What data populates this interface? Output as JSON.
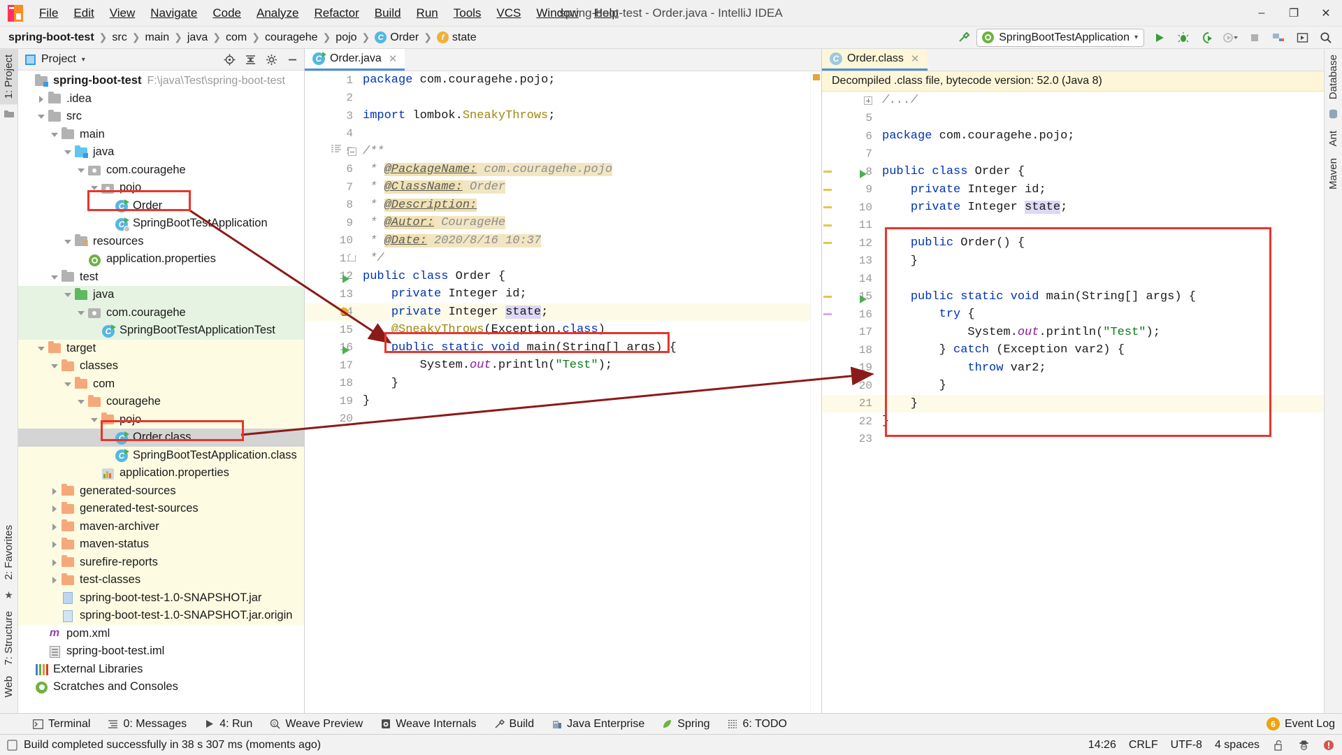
{
  "window": {
    "title": "spring-boot-test - Order.java - IntelliJ IDEA",
    "logo_letters": "IJ",
    "minimize": "–",
    "maximize": "❐",
    "close": "✕"
  },
  "menubar": [
    {
      "label": "File"
    },
    {
      "label": "Edit"
    },
    {
      "label": "View"
    },
    {
      "label": "Navigate"
    },
    {
      "label": "Code"
    },
    {
      "label": "Analyze"
    },
    {
      "label": "Refactor"
    },
    {
      "label": "Build"
    },
    {
      "label": "Run"
    },
    {
      "label": "Tools"
    },
    {
      "label": "VCS"
    },
    {
      "label": "Window"
    },
    {
      "label": "Help"
    }
  ],
  "breadcrumbs": [
    {
      "label": "spring-boot-test",
      "icon": "none",
      "bold": true
    },
    {
      "label": "src",
      "icon": "none",
      "bold": false
    },
    {
      "label": "main",
      "icon": "none",
      "bold": false
    },
    {
      "label": "java",
      "icon": "none",
      "bold": false
    },
    {
      "label": "com",
      "icon": "none",
      "bold": false
    },
    {
      "label": "couragehe",
      "icon": "none",
      "bold": false
    },
    {
      "label": "pojo",
      "icon": "none",
      "bold": false
    },
    {
      "label": "Order",
      "icon": "class-icon",
      "bold": false
    },
    {
      "label": "state",
      "icon": "field-icon",
      "bold": false
    }
  ],
  "toolbar": {
    "build_icon": "hammer-icon",
    "run_config": "SpringBootTestApplication",
    "run_config_icon": "spring-icon",
    "dropdown_caret": "▾",
    "buttons": [
      {
        "name": "run-button",
        "glyph": "▶"
      },
      {
        "name": "debug-button",
        "glyph": "🐞"
      },
      {
        "name": "run-with-coverage-button",
        "glyph": "⭯"
      },
      {
        "name": "profile-button",
        "glyph": "◔"
      },
      {
        "name": "stop-button",
        "glyph": "■"
      },
      {
        "name": "project-structure-button",
        "glyph": "▤"
      },
      {
        "name": "select-opened-file-button",
        "glyph": "▣"
      },
      {
        "name": "search-everywhere-button",
        "glyph": "⚲"
      }
    ]
  },
  "left_strip": {
    "project_tab": "1: Project",
    "favorites_tab": "2: Favorites",
    "structure_tab": "7: Structure",
    "web_tab": "Web"
  },
  "right_strip": {
    "database_tab": "Database",
    "ant_tab": "Ant",
    "maven_tab": "Maven"
  },
  "project_panel": {
    "title": "Project",
    "caret": "▾",
    "icons": [
      {
        "name": "locate-icon",
        "glyph": "⊕"
      },
      {
        "name": "collapse-all-icon",
        "glyph": "≡"
      },
      {
        "name": "settings-gear-icon",
        "glyph": "⚙"
      },
      {
        "name": "hide-panel-icon",
        "glyph": "—"
      }
    ],
    "tree": [
      {
        "label": "spring-boot-test",
        "path": "F:\\java\\Test\\spring-boot-test",
        "indent": 0,
        "arrow": "none",
        "icon": "module-folder",
        "bold": true,
        "hl": ""
      },
      {
        "label": ".idea",
        "path": "",
        "indent": 1,
        "arrow": "closed",
        "icon": "folder-grey",
        "bold": false,
        "hl": ""
      },
      {
        "label": "src",
        "path": "",
        "indent": 1,
        "arrow": "open",
        "icon": "folder-grey",
        "bold": false,
        "hl": ""
      },
      {
        "label": "main",
        "path": "",
        "indent": 2,
        "arrow": "open",
        "icon": "folder-grey",
        "bold": false,
        "hl": ""
      },
      {
        "label": "java",
        "path": "",
        "indent": 3,
        "arrow": "open",
        "icon": "folder-blue-src",
        "bold": false,
        "hl": ""
      },
      {
        "label": "com.couragehe",
        "path": "",
        "indent": 4,
        "arrow": "open",
        "icon": "package",
        "bold": false,
        "hl": ""
      },
      {
        "label": "pojo",
        "path": "",
        "indent": 5,
        "arrow": "open",
        "icon": "package",
        "bold": false,
        "hl": ""
      },
      {
        "label": "Order",
        "path": "",
        "indent": 6,
        "arrow": "none",
        "icon": "java-class-run",
        "bold": false,
        "hl": ""
      },
      {
        "label": "SpringBootTestApplication",
        "path": "",
        "indent": 6,
        "arrow": "none",
        "icon": "java-class-spring",
        "bold": false,
        "hl": ""
      },
      {
        "label": "resources",
        "path": "",
        "indent": 3,
        "arrow": "open",
        "icon": "folder-res",
        "bold": false,
        "hl": ""
      },
      {
        "label": "application.properties",
        "path": "",
        "indent": 4,
        "arrow": "none",
        "icon": "spring-leaf",
        "bold": false,
        "hl": ""
      },
      {
        "label": "test",
        "path": "",
        "indent": 2,
        "arrow": "open",
        "icon": "folder-grey",
        "bold": false,
        "hl": ""
      },
      {
        "label": "java",
        "path": "",
        "indent": 3,
        "arrow": "open",
        "icon": "folder-green",
        "bold": false,
        "hl": "green"
      },
      {
        "label": "com.couragehe",
        "path": "",
        "indent": 4,
        "arrow": "open",
        "icon": "package",
        "bold": false,
        "hl": "green"
      },
      {
        "label": "SpringBootTestApplicationTest",
        "path": "",
        "indent": 5,
        "arrow": "none",
        "icon": "java-class-run",
        "bold": false,
        "hl": "green"
      },
      {
        "label": "target",
        "path": "",
        "indent": 1,
        "arrow": "open",
        "icon": "folder-orange",
        "bold": false,
        "hl": "yellow"
      },
      {
        "label": "classes",
        "path": "",
        "indent": 2,
        "arrow": "open",
        "icon": "folder-orange",
        "bold": false,
        "hl": "yellow"
      },
      {
        "label": "com",
        "path": "",
        "indent": 3,
        "arrow": "open",
        "icon": "folder-orange",
        "bold": false,
        "hl": "yellow"
      },
      {
        "label": "couragehe",
        "path": "",
        "indent": 4,
        "arrow": "open",
        "icon": "folder-orange",
        "bold": false,
        "hl": "yellow"
      },
      {
        "label": "pojo",
        "path": "",
        "indent": 5,
        "arrow": "open",
        "icon": "folder-orange",
        "bold": false,
        "hl": "yellow"
      },
      {
        "label": "Order.class",
        "path": "",
        "indent": 6,
        "arrow": "none",
        "icon": "java-class-run",
        "bold": false,
        "hl": "selected"
      },
      {
        "label": "SpringBootTestApplication.class",
        "path": "",
        "indent": 6,
        "arrow": "none",
        "icon": "java-class-run",
        "bold": false,
        "hl": "yellow"
      },
      {
        "label": "application.properties",
        "path": "",
        "indent": 5,
        "arrow": "none",
        "icon": "properties",
        "bold": false,
        "hl": "yellow"
      },
      {
        "label": "generated-sources",
        "path": "",
        "indent": 2,
        "arrow": "closed",
        "icon": "folder-orange",
        "bold": false,
        "hl": "yellow"
      },
      {
        "label": "generated-test-sources",
        "path": "",
        "indent": 2,
        "arrow": "closed",
        "icon": "folder-orange",
        "bold": false,
        "hl": "yellow"
      },
      {
        "label": "maven-archiver",
        "path": "",
        "indent": 2,
        "arrow": "closed",
        "icon": "folder-orange",
        "bold": false,
        "hl": "yellow"
      },
      {
        "label": "maven-status",
        "path": "",
        "indent": 2,
        "arrow": "closed",
        "icon": "folder-orange",
        "bold": false,
        "hl": "yellow"
      },
      {
        "label": "surefire-reports",
        "path": "",
        "indent": 2,
        "arrow": "closed",
        "icon": "folder-orange",
        "bold": false,
        "hl": "yellow"
      },
      {
        "label": "test-classes",
        "path": "",
        "indent": 2,
        "arrow": "closed",
        "icon": "folder-orange",
        "bold": false,
        "hl": "yellow"
      },
      {
        "label": "spring-boot-test-1.0-SNAPSHOT.jar",
        "path": "",
        "indent": 2,
        "arrow": "none",
        "icon": "jar",
        "bold": false,
        "hl": "yellow"
      },
      {
        "label": "spring-boot-test-1.0-SNAPSHOT.jar.origin",
        "path": "",
        "indent": 2,
        "arrow": "none",
        "icon": "jar-unknown",
        "bold": false,
        "hl": "yellow"
      },
      {
        "label": "pom.xml",
        "path": "",
        "indent": 1,
        "arrow": "none",
        "icon": "maven-m",
        "bold": false,
        "hl": ""
      },
      {
        "label": "spring-boot-test.iml",
        "path": "",
        "indent": 1,
        "arrow": "none",
        "icon": "iml",
        "bold": false,
        "hl": ""
      },
      {
        "label": "External Libraries",
        "path": "",
        "indent": 0,
        "arrow": "none",
        "icon": "libraries",
        "bold": false,
        "hl": ""
      },
      {
        "label": "Scratches and Consoles",
        "path": "",
        "indent": 0,
        "arrow": "none",
        "icon": "scratches",
        "bold": false,
        "hl": ""
      }
    ]
  },
  "editor_left": {
    "tab_label": "Order.java",
    "tab_close": "✕",
    "lines": [
      {
        "n": "1",
        "text": "package com.couragehe.pojo;",
        "hl": false
      },
      {
        "n": "2",
        "text": "",
        "hl": false
      },
      {
        "n": "3",
        "text": "import lombok.SneakyThrows;",
        "hl": false
      },
      {
        "n": "4",
        "text": "",
        "hl": false
      },
      {
        "n": "5",
        "text": "/**",
        "hl": false
      },
      {
        "n": "6",
        "text": " * @PackageName: com.couragehe.pojo",
        "hl": false
      },
      {
        "n": "7",
        "text": " * @ClassName: Order",
        "hl": false
      },
      {
        "n": "8",
        "text": " * @Description:",
        "hl": false
      },
      {
        "n": "9",
        "text": " * @Autor: CourageHe",
        "hl": false
      },
      {
        "n": "10",
        "text": " * @Date: 2020/8/16 10:37",
        "hl": false
      },
      {
        "n": "11",
        "text": " */",
        "hl": false
      },
      {
        "n": "12",
        "text": "public class Order {",
        "hl": false
      },
      {
        "n": "13",
        "text": "    private Integer id;",
        "hl": false
      },
      {
        "n": "14",
        "text": "    private Integer state;",
        "hl": true
      },
      {
        "n": "15",
        "text": "    @SneakyThrows(Exception.class)",
        "hl": false
      },
      {
        "n": "16",
        "text": "    public static void main(String[] args) {",
        "hl": false
      },
      {
        "n": "17",
        "text": "        System.out.println(\"Test\");",
        "hl": false
      },
      {
        "n": "18",
        "text": "    }",
        "hl": false
      },
      {
        "n": "19",
        "text": "}",
        "hl": false
      },
      {
        "n": "20",
        "text": "",
        "hl": false
      }
    ]
  },
  "editor_right": {
    "tab_label": "Order.class",
    "tab_close": "✕",
    "notice": "Decompiled .class file, bytecode version: 52.0 (Java 8)",
    "lines": [
      {
        "n": "1",
        "text": "/.../",
        "hl": false
      },
      {
        "n": "5",
        "text": "",
        "hl": false
      },
      {
        "n": "6",
        "text": "package com.couragehe.pojo;",
        "hl": false
      },
      {
        "n": "7",
        "text": "",
        "hl": false
      },
      {
        "n": "8",
        "text": "public class Order {",
        "hl": false
      },
      {
        "n": "9",
        "text": "    private Integer id;",
        "hl": false
      },
      {
        "n": "10",
        "text": "    private Integer state;",
        "hl": false
      },
      {
        "n": "11",
        "text": "",
        "hl": false
      },
      {
        "n": "12",
        "text": "    public Order() {",
        "hl": false
      },
      {
        "n": "13",
        "text": "    }",
        "hl": false
      },
      {
        "n": "14",
        "text": "",
        "hl": false
      },
      {
        "n": "15",
        "text": "    public static void main(String[] args) {",
        "hl": false
      },
      {
        "n": "16",
        "text": "        try {",
        "hl": false
      },
      {
        "n": "17",
        "text": "            System.out.println(\"Test\");",
        "hl": false
      },
      {
        "n": "18",
        "text": "        } catch (Exception var2) {",
        "hl": false
      },
      {
        "n": "19",
        "text": "            throw var2;",
        "hl": false
      },
      {
        "n": "20",
        "text": "        }",
        "hl": false
      },
      {
        "n": "21",
        "text": "    }",
        "hl": true
      },
      {
        "n": "22",
        "text": "}",
        "hl": false
      },
      {
        "n": "23",
        "text": "",
        "hl": false
      }
    ]
  },
  "tool_window_bar": {
    "items": [
      {
        "label": "Terminal",
        "icon": "terminal-icon",
        "mnemonic": ""
      },
      {
        "label": "0: Messages",
        "icon": "messages-icon",
        "mnemonic": "0"
      },
      {
        "label": "4: Run",
        "icon": "run-icon",
        "mnemonic": "4"
      },
      {
        "label": "Weave Preview",
        "icon": "weave-preview-icon",
        "mnemonic": ""
      },
      {
        "label": "Weave Internals",
        "icon": "weave-internals-icon",
        "mnemonic": ""
      },
      {
        "label": "Build",
        "icon": "build-hammer-icon",
        "mnemonic": ""
      },
      {
        "label": "Java Enterprise",
        "icon": "java-enterprise-icon",
        "mnemonic": ""
      },
      {
        "label": "Spring",
        "icon": "spring-leaf-icon",
        "mnemonic": ""
      },
      {
        "label": "6: TODO",
        "icon": "todo-icon",
        "mnemonic": "6"
      }
    ],
    "event_log": "Event Log",
    "event_log_count": "6"
  },
  "status_bar": {
    "message": "Build completed successfully in 38 s 307 ms (moments ago)",
    "message_icon": "build-status-icon",
    "time": "14:26",
    "line_separator": "CRLF",
    "encoding": "UTF-8",
    "indent": "4 spaces",
    "lock_icon": "lock-open-icon",
    "inspector_icon": "hector-inspector-icon",
    "error_icon": "error-circle-icon"
  },
  "annotations": {
    "highlight_color": "#e8352c",
    "arrow_color": "#8b1a1a",
    "boxes": [
      {
        "name": "order-java-tree-highlight"
      },
      {
        "name": "order-class-tree-highlight"
      },
      {
        "name": "sneaky-throws-code-highlight"
      },
      {
        "name": "decompiled-body-highlight"
      }
    ]
  }
}
